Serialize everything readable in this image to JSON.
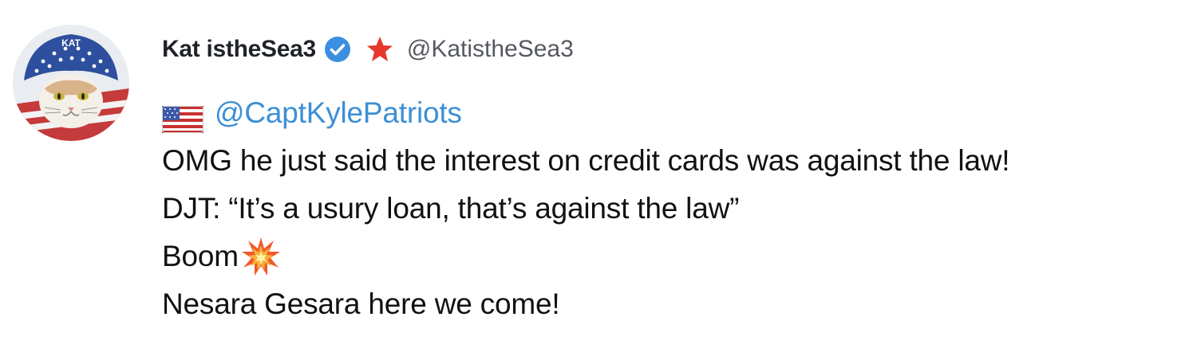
{
  "post": {
    "author": {
      "display_name": "Kat istheSea3",
      "handle": "@KatistheSea3",
      "avatar_text": "KAT",
      "verified": true,
      "verified_color": "#3b8ee0",
      "star_color": "#e5372b"
    },
    "mention": {
      "flag_icon": "us-flag-icon",
      "handle": "@CaptKylePatriots",
      "color": "#3d8fd6"
    },
    "lines": [
      "OMG he just said the interest on credit cards was against the law!",
      "DJT: “It’s a usury loan, that’s against the law”",
      "Boom",
      "Nesara Gesara here we come!"
    ],
    "boom_icon": "collision-icon"
  }
}
